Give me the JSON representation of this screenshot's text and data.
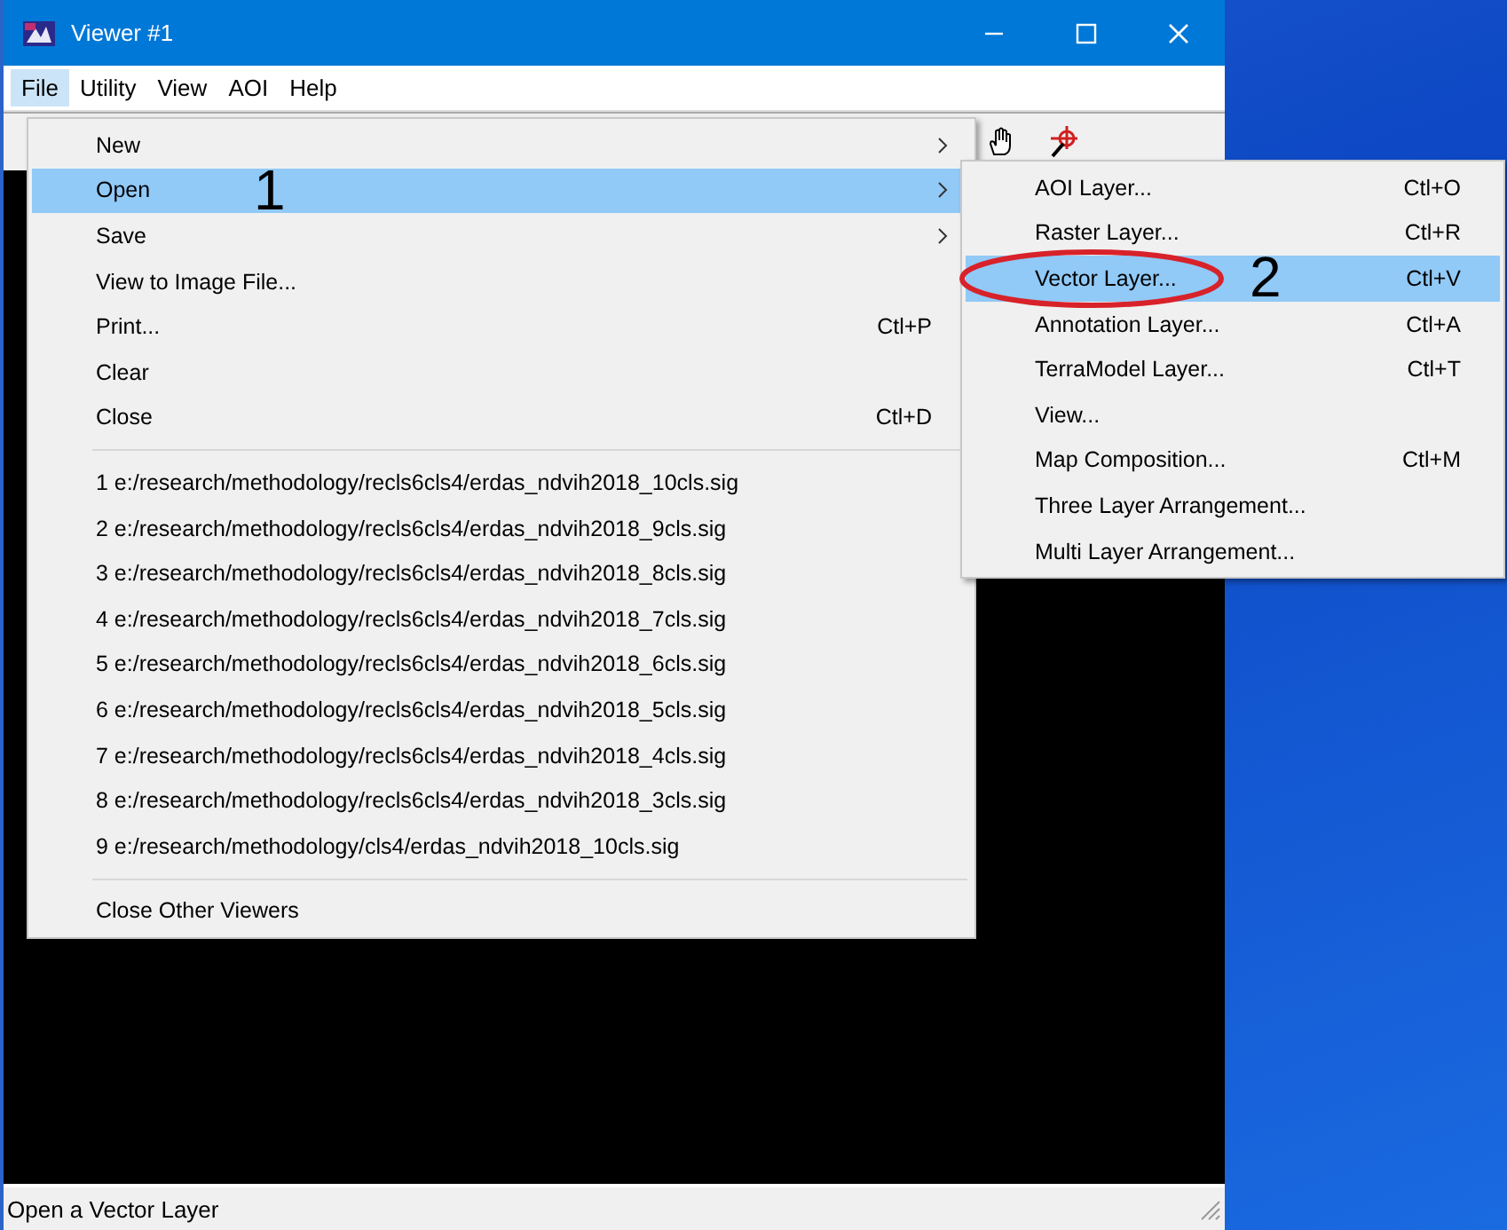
{
  "window": {
    "title": "Viewer #1"
  },
  "menubar": [
    {
      "label": "File",
      "selected": true
    },
    {
      "label": "Utility",
      "selected": false
    },
    {
      "label": "View",
      "selected": false
    },
    {
      "label": "AOI",
      "selected": false
    },
    {
      "label": "Help",
      "selected": false
    }
  ],
  "file_menu": [
    {
      "kind": "item",
      "label": "New",
      "submenu": true,
      "selected": false
    },
    {
      "kind": "item",
      "label": "Open",
      "submenu": true,
      "selected": true,
      "callout": "1"
    },
    {
      "kind": "item",
      "label": "Save",
      "submenu": true,
      "selected": false
    },
    {
      "kind": "item",
      "label": "View to Image File...",
      "submenu": false,
      "selected": false
    },
    {
      "kind": "item",
      "label": "Print...",
      "shortcut": "Ctl+P",
      "submenu": false,
      "selected": false
    },
    {
      "kind": "item",
      "label": "Clear",
      "submenu": false,
      "selected": false
    },
    {
      "kind": "item",
      "label": "Close",
      "shortcut": "Ctl+D",
      "submenu": false,
      "selected": false
    },
    {
      "kind": "separator"
    },
    {
      "kind": "item",
      "label": "1 e:/research/methodology/recls6cls4/erdas_ndvih2018_10cls.sig",
      "submenu": false,
      "selected": false
    },
    {
      "kind": "item",
      "label": "2 e:/research/methodology/recls6cls4/erdas_ndvih2018_9cls.sig",
      "submenu": false,
      "selected": false
    },
    {
      "kind": "item",
      "label": "3 e:/research/methodology/recls6cls4/erdas_ndvih2018_8cls.sig",
      "submenu": false,
      "selected": false
    },
    {
      "kind": "item",
      "label": "4 e:/research/methodology/recls6cls4/erdas_ndvih2018_7cls.sig",
      "submenu": false,
      "selected": false
    },
    {
      "kind": "item",
      "label": "5 e:/research/methodology/recls6cls4/erdas_ndvih2018_6cls.sig",
      "submenu": false,
      "selected": false
    },
    {
      "kind": "item",
      "label": "6 e:/research/methodology/recls6cls4/erdas_ndvih2018_5cls.sig",
      "submenu": false,
      "selected": false
    },
    {
      "kind": "item",
      "label": "7 e:/research/methodology/recls6cls4/erdas_ndvih2018_4cls.sig",
      "submenu": false,
      "selected": false
    },
    {
      "kind": "item",
      "label": "8 e:/research/methodology/recls6cls4/erdas_ndvih2018_3cls.sig",
      "submenu": false,
      "selected": false
    },
    {
      "kind": "item",
      "label": "9 e:/research/methodology/cls4/erdas_ndvih2018_10cls.sig",
      "submenu": false,
      "selected": false
    },
    {
      "kind": "separator"
    },
    {
      "kind": "item",
      "label": "Close Other Viewers",
      "submenu": false,
      "selected": false
    }
  ],
  "open_submenu": [
    {
      "kind": "item",
      "label": "AOI Layer...",
      "shortcut": "Ctl+O",
      "selected": false,
      "circled": false
    },
    {
      "kind": "item",
      "label": "Raster Layer...",
      "shortcut": "Ctl+R",
      "selected": false,
      "circled": false
    },
    {
      "kind": "item",
      "label": "Vector Layer...",
      "shortcut": "Ctl+V",
      "selected": true,
      "circled": true,
      "callout": "2"
    },
    {
      "kind": "item",
      "label": "Annotation Layer...",
      "shortcut": "Ctl+A",
      "selected": false,
      "circled": false
    },
    {
      "kind": "item",
      "label": "TerraModel Layer...",
      "shortcut": "Ctl+T",
      "selected": false,
      "circled": false
    },
    {
      "kind": "item",
      "label": "View...",
      "selected": false,
      "circled": false
    },
    {
      "kind": "item",
      "label": "Map Composition...",
      "shortcut": "Ctl+M",
      "selected": false,
      "circled": false
    },
    {
      "kind": "item",
      "label": "Three Layer Arrangement...",
      "selected": false,
      "circled": false
    },
    {
      "kind": "item",
      "label": "Multi Layer Arrangement...",
      "selected": false,
      "circled": false
    }
  ],
  "status_bar": {
    "text": "Open a Vector Layer"
  }
}
